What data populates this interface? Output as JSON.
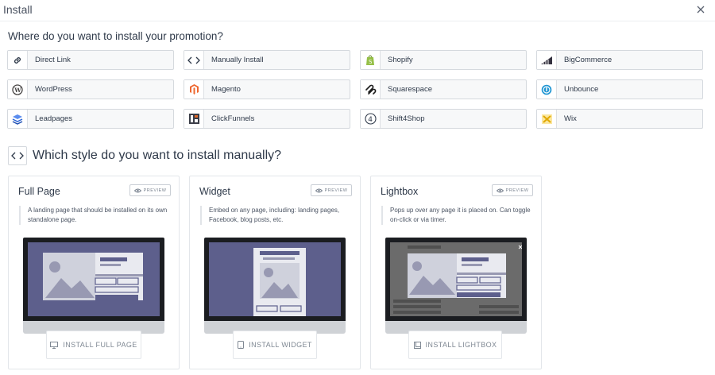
{
  "header": {
    "title": "Install"
  },
  "question": "Where do you want to install your promotion?",
  "platforms": [
    {
      "label": "Direct Link",
      "icon": "link-icon"
    },
    {
      "label": "Manually Install",
      "icon": "code-icon"
    },
    {
      "label": "Shopify",
      "icon": "shopify-icon"
    },
    {
      "label": "BigCommerce",
      "icon": "bigcommerce-icon"
    },
    {
      "label": "WordPress",
      "icon": "wordpress-icon"
    },
    {
      "label": "Magento",
      "icon": "magento-icon"
    },
    {
      "label": "Squarespace",
      "icon": "squarespace-icon"
    },
    {
      "label": "Unbounce",
      "icon": "unbounce-icon"
    },
    {
      "label": "Leadpages",
      "icon": "leadpages-icon"
    },
    {
      "label": "ClickFunnels",
      "icon": "clickfunnels-icon"
    },
    {
      "label": "Shift4Shop",
      "icon": "shift4shop-icon"
    },
    {
      "label": "Wix",
      "icon": "wix-icon"
    }
  ],
  "manual": {
    "heading": "Which style do you want to install manually?",
    "icon": "code-icon"
  },
  "preview_label": "PREVIEW",
  "cards": [
    {
      "title": "Full Page",
      "desc": "A landing page that should be installed on its own standalone page.",
      "install": "INSTALL FULL PAGE",
      "install_icon": "monitor-icon"
    },
    {
      "title": "Widget",
      "desc": "Embed on any page, including: landing pages, Facebook, blog posts, etc.",
      "install": "INSTALL WIDGET",
      "install_icon": "tablet-icon"
    },
    {
      "title": "Lightbox",
      "desc": "Pops up over any page it is placed on. Can toggle on-click or via timer.",
      "install": "INSTALL LIGHTBOX",
      "install_icon": "window-icon"
    }
  ],
  "colors": {
    "text": "#2f3a4a",
    "screen": "#5d5f8c",
    "border": "#d5d9de",
    "shopify": "#95bf47",
    "magento": "#ee672f",
    "unbounce": "#2196d3",
    "leadpages": "#2e66d6",
    "wix": "#f4c542"
  }
}
